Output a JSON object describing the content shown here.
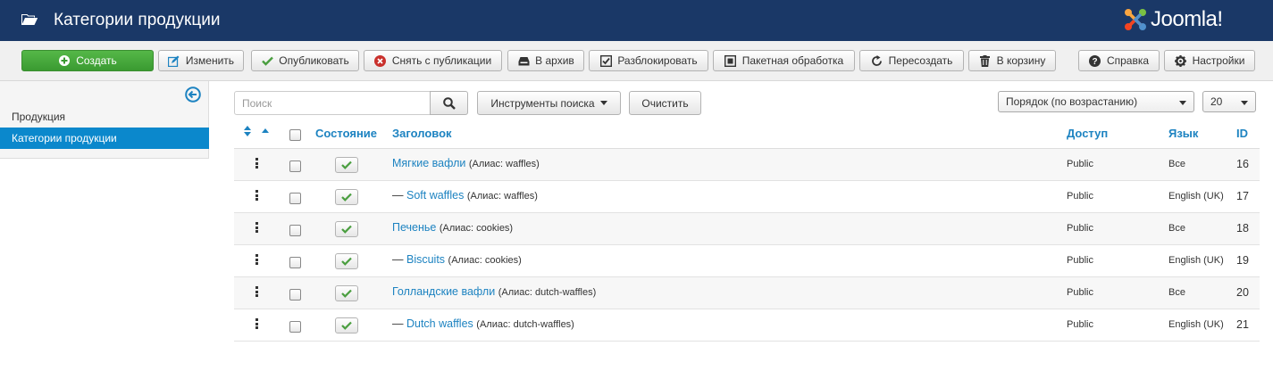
{
  "header": {
    "title": "Категории продукции",
    "logo_text": "Joomla!",
    "brand_color": "#1a3867"
  },
  "toolbar": {
    "create": "Создать",
    "edit": "Изменить",
    "publish": "Опубликовать",
    "unpublish": "Снять с публикации",
    "archive": "В архив",
    "unlock": "Разблокировать",
    "batch": "Пакетная обработка",
    "rebuild": "Пересоздать",
    "trash": "В корзину",
    "help": "Справка",
    "options": "Настройки"
  },
  "sidebar": {
    "items": [
      {
        "label": "Продукция",
        "active": false
      },
      {
        "label": "Категории продукции",
        "active": true
      }
    ]
  },
  "filters": {
    "search_placeholder": "Поиск",
    "search_tools": "Инструменты поиска",
    "clear": "Очистить",
    "ordering": "Порядок (по возрастанию)",
    "limit": "20"
  },
  "table": {
    "columns": {
      "status": "Состояние",
      "title": "Заголовок",
      "access": "Доступ",
      "language": "Язык",
      "id": "ID"
    },
    "rows": [
      {
        "dash": "",
        "title": "Мягкие вафли",
        "alias": "(Алиас: waffles)",
        "access": "Public",
        "language": "Все",
        "id": "16"
      },
      {
        "dash": "— ",
        "title": "Soft waffles",
        "alias": "(Алиас: waffles)",
        "access": "Public",
        "language": "English (UK)",
        "id": "17"
      },
      {
        "dash": "",
        "title": "Печенье",
        "alias": "(Алиас: cookies)",
        "access": "Public",
        "language": "Все",
        "id": "18"
      },
      {
        "dash": "— ",
        "title": "Biscuits",
        "alias": "(Алиас: cookies)",
        "access": "Public",
        "language": "English (UK)",
        "id": "19"
      },
      {
        "dash": "",
        "title": "Голландские вафли",
        "alias": "(Алиас: dutch-waffles)",
        "access": "Public",
        "language": "Все",
        "id": "20"
      },
      {
        "dash": "— ",
        "title": "Dutch waffles",
        "alias": "(Алиас: dutch-waffles)",
        "access": "Public",
        "language": "English (UK)",
        "id": "21"
      }
    ]
  }
}
